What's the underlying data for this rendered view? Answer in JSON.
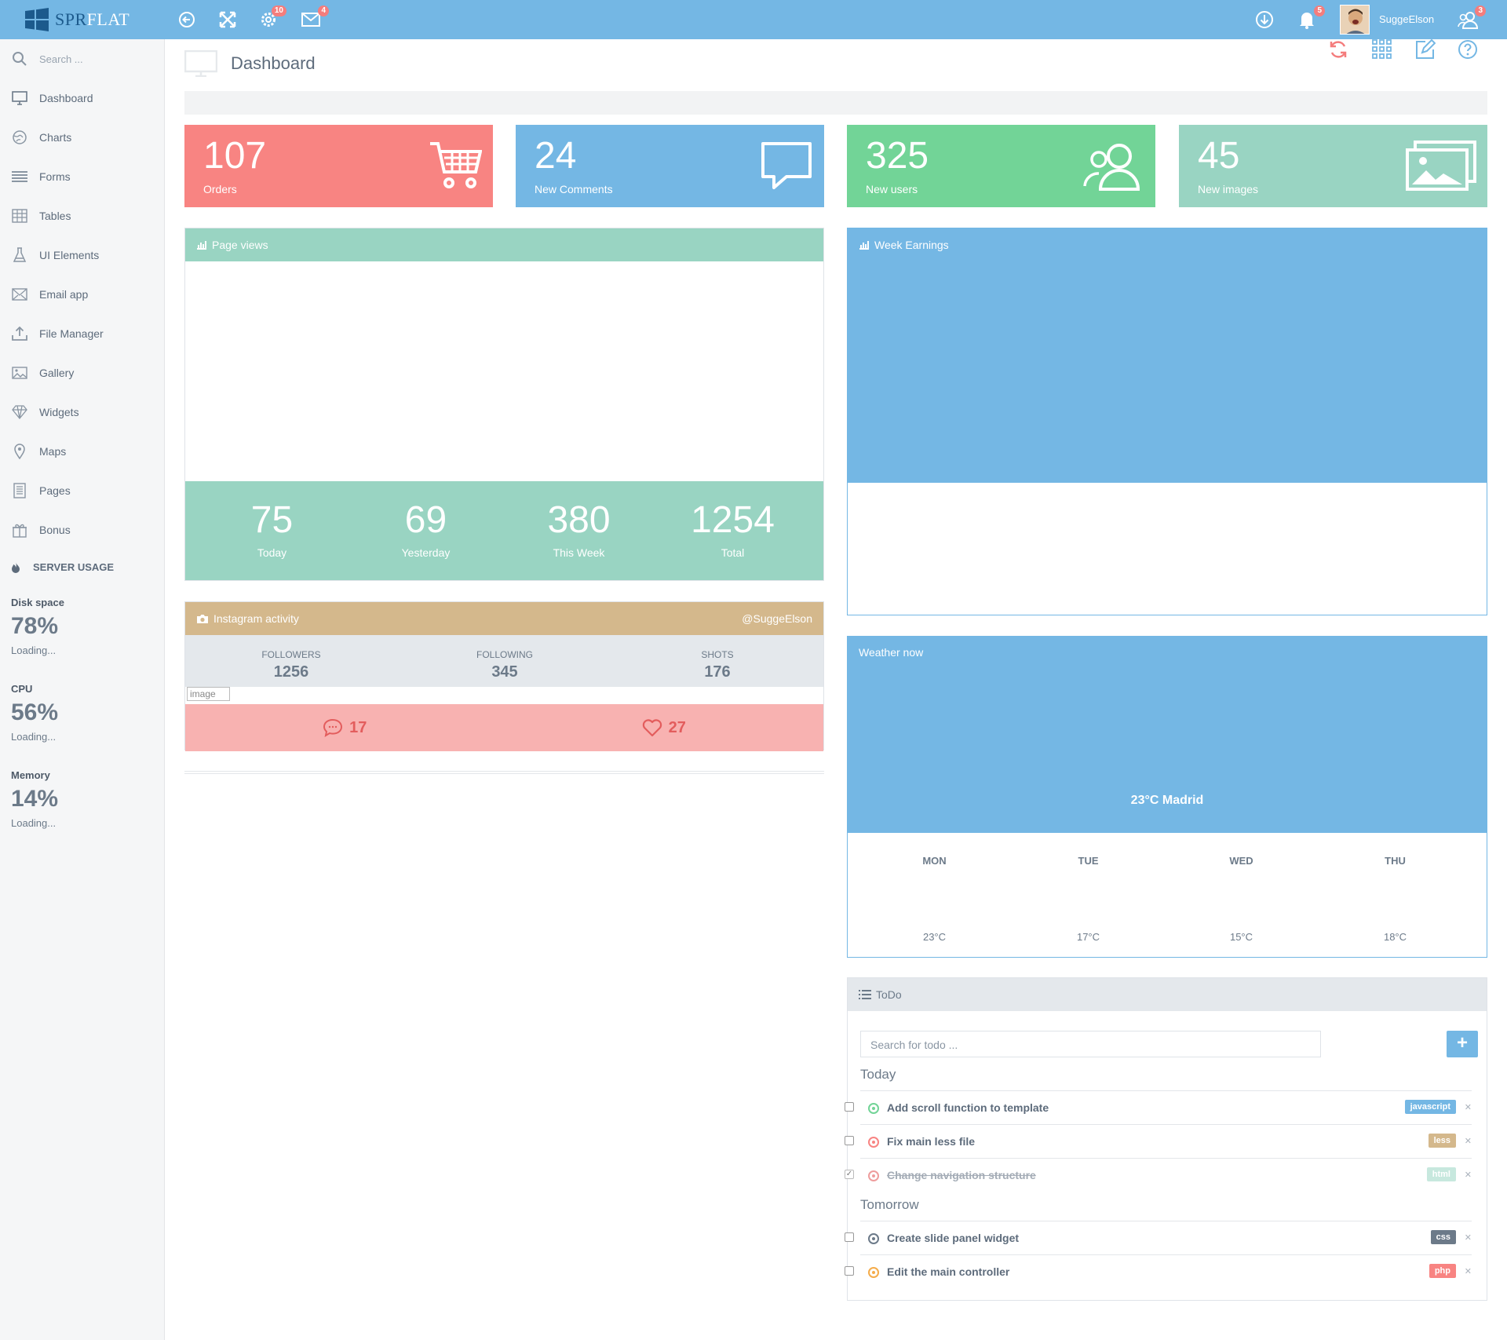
{
  "app": {
    "logo_left": "SPR",
    "logo_right": "FLAT",
    "user_name": "SuggeElson"
  },
  "topbar": {
    "settings_badge": "10",
    "mail_badge": "4",
    "notifications_badge": "5",
    "users_badge": "3"
  },
  "sidebar": {
    "search_placeholder": "Search ...",
    "items": [
      {
        "label": "Dashboard",
        "icon": "monitor-icon"
      },
      {
        "label": "Charts",
        "icon": "globe-icon"
      },
      {
        "label": "Forms",
        "icon": "list-icon"
      },
      {
        "label": "Tables",
        "icon": "table-icon"
      },
      {
        "label": "UI Elements",
        "icon": "flask-icon"
      },
      {
        "label": "Email app",
        "icon": "envelope-icon"
      },
      {
        "label": "File Manager",
        "icon": "upload-icon"
      },
      {
        "label": "Gallery",
        "icon": "image-icon"
      },
      {
        "label": "Widgets",
        "icon": "diamond-icon"
      },
      {
        "label": "Maps",
        "icon": "map-pin-icon"
      },
      {
        "label": "Pages",
        "icon": "page-icon"
      },
      {
        "label": "Bonus",
        "icon": "gift-icon"
      }
    ],
    "server_usage_title": "SERVER USAGE",
    "usage": [
      {
        "label": "Disk space",
        "value": "78%",
        "status": "Loading..."
      },
      {
        "label": "CPU",
        "value": "56%",
        "status": "Loading..."
      },
      {
        "label": "Memory",
        "value": "14%",
        "status": "Loading..."
      }
    ]
  },
  "page": {
    "title": "Dashboard"
  },
  "stats": [
    {
      "value": "107",
      "label": "Orders",
      "color": "#f88482"
    },
    {
      "value": "24",
      "label": "New Comments",
      "color": "#74b7e4"
    },
    {
      "value": "325",
      "label": "New users",
      "color": "#72d497"
    },
    {
      "value": "45",
      "label": "New images",
      "color": "#99d4c2"
    }
  ],
  "page_views": {
    "title": "Page views",
    "stats": [
      {
        "value": "75",
        "label": "Today"
      },
      {
        "value": "69",
        "label": "Yesterday"
      },
      {
        "value": "380",
        "label": "This Week"
      },
      {
        "value": "1254",
        "label": "Total"
      }
    ]
  },
  "week_earnings": {
    "title": "Week Earnings"
  },
  "instagram": {
    "title": "Instagram activity",
    "handle": "@SuggeElson",
    "followers_label": "FOLLOWERS",
    "followers": "1256",
    "following_label": "FOLLOWING",
    "following": "345",
    "shots_label": "SHOTS",
    "shots": "176",
    "image_alt": "image",
    "comments": "17",
    "likes": "27"
  },
  "weather": {
    "title": "Weather now",
    "current": "23°C Madrid",
    "days": [
      {
        "day": "MON",
        "temp": "23°C"
      },
      {
        "day": "TUE",
        "temp": "17°C"
      },
      {
        "day": "WED",
        "temp": "15°C"
      },
      {
        "day": "THU",
        "temp": "18°C"
      }
    ]
  },
  "todo": {
    "title": "ToDo",
    "search_placeholder": "Search for todo ...",
    "add_label": "+",
    "today_label": "Today",
    "tomorrow_label": "Tomorrow",
    "today": [
      {
        "text": "Add scroll function to template",
        "tag": "javascript",
        "tag_color": "#74b7e4",
        "status_color": "#72d497",
        "done": false
      },
      {
        "text": "Fix main less file",
        "tag": "less",
        "tag_color": "#d4b88c",
        "status_color": "#f88482",
        "done": false
      },
      {
        "text": "Change navigation structure",
        "tag": "html",
        "tag_color": "#99d4c2",
        "status_color": "#f88482",
        "done": true
      }
    ],
    "tomorrow": [
      {
        "text": "Create slide panel widget",
        "tag": "css",
        "tag_color": "#6c7a89",
        "status_color": "#6c7a89",
        "done": false
      },
      {
        "text": "Edit the main controller",
        "tag": "php",
        "tag_color": "#f88482",
        "status_color": "#f5ac4a",
        "done": false
      }
    ]
  }
}
